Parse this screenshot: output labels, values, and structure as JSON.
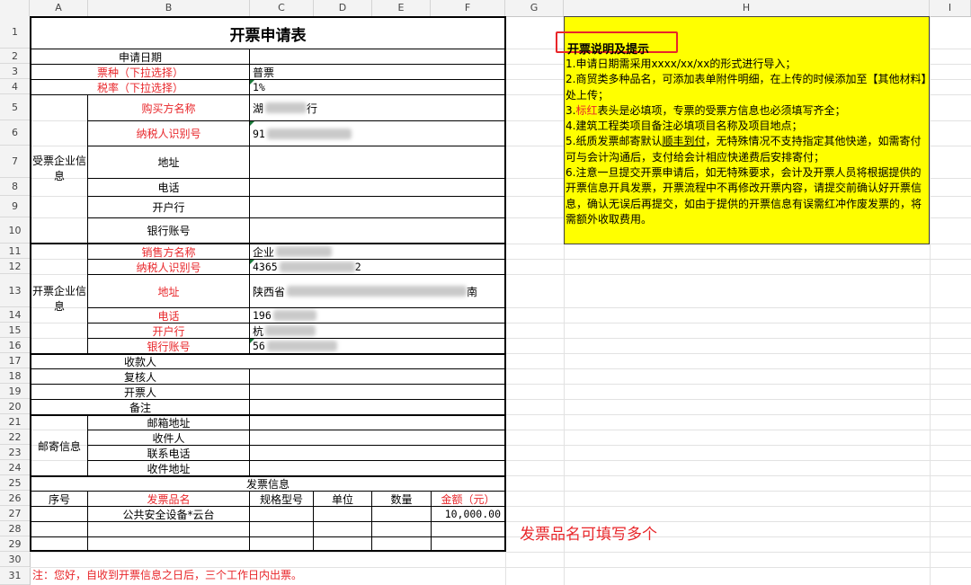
{
  "columns": [
    "A",
    "B",
    "C",
    "D",
    "E",
    "F",
    "G",
    "H",
    "I"
  ],
  "rows": [
    "1",
    "2",
    "3",
    "4",
    "5",
    "6",
    "7",
    "8",
    "9",
    "10",
    "11",
    "12",
    "13",
    "14",
    "15",
    "16",
    "17",
    "18",
    "19",
    "20",
    "21",
    "22",
    "23",
    "24",
    "25",
    "26",
    "27",
    "28",
    "29",
    "30",
    "31"
  ],
  "form": {
    "title": "开票申请表",
    "apply_date_label": "申请日期",
    "ticket_type_label": "票种（下拉选择）",
    "ticket_type_value": "普票",
    "tax_rate_label": "税率（下拉选择）",
    "tax_rate_value": "1%",
    "buyer_section_label": "受票企业信息",
    "buyer": {
      "name_label": "购买方名称",
      "name_value": "湖",
      "name_tail": "行",
      "tax_id_label": "纳税人识别号",
      "tax_id_value": "91",
      "address_label": "地址",
      "phone_label": "电话",
      "bank_label": "开户行",
      "account_label": "银行账号"
    },
    "seller_section_label": "开票企业信息",
    "seller": {
      "name_label": "销售方名称",
      "name_value": "企业",
      "tax_id_label": "纳税人识别号",
      "tax_id_value": "4365",
      "tax_id_tail": "2",
      "address_label": "地址",
      "address_value": "陕西省",
      "address_tail": "南",
      "phone_label": "电话",
      "phone_value": "196",
      "bank_label": "开户行",
      "bank_value": "杭",
      "account_label": "银行账号",
      "account_value": "56"
    },
    "payee_label": "收款人",
    "reviewer_label": "复核人",
    "issuer_label": "开票人",
    "remark_label": "备注",
    "mail_section_label": "邮寄信息",
    "mail": {
      "email_label": "邮箱地址",
      "receiver_label": "收件人",
      "phone_label": "联系电话",
      "address_label": "收件地址"
    },
    "invoice_info_label": "发票信息",
    "table_headers": {
      "seq": "序号",
      "item": "发票品名",
      "spec": "规格型号",
      "unit": "单位",
      "qty": "数量",
      "amount": "金额（元）"
    },
    "rows": [
      {
        "seq": "",
        "item": "公共安全设备*云台",
        "spec": "",
        "unit": "",
        "qty": "",
        "amount": "10,000.00"
      }
    ]
  },
  "note": {
    "title": "开票说明及提示",
    "items": [
      "1.申请日期需采用xxxx/xx/xx的形式进行导入；",
      "2.商贸类多种品名，可添加表单附件明细，在上传的时候添加至【其他材料】处上传；",
      "3.",
      "4.建筑工程类项目备注必填项目名称及项目地点；",
      "5.纸质发票邮寄默认",
      "6.注意一旦提交开票申请后，如无特殊要求，会计及开票人员将根据提供的开票信息开具发票，开票流程中不再修改开票内容，请提交前确认好开票信息，确认无误后再提交，如由于提供的开票信息有误需红冲作废发票的，将需额外收取费用。"
    ],
    "item3_red": "标红",
    "item3_rest": "表头是必填项，专票的受票方信息也必须填写齐全；",
    "item5_underline": "顺丰到付",
    "item5_rest": "，无特殊情况不支持指定其他快递，如需寄付可与会计沟通后，支付给会计相应快递费后安排寄付；"
  },
  "callout": "发票品名可填写多个",
  "footer": "注：您好，自收到开票信息之日后，三个工作日内出票。",
  "colors": {
    "red": "#e8262a",
    "note_bg": "#ffff00",
    "header_bg": "#f3f3f3"
  }
}
